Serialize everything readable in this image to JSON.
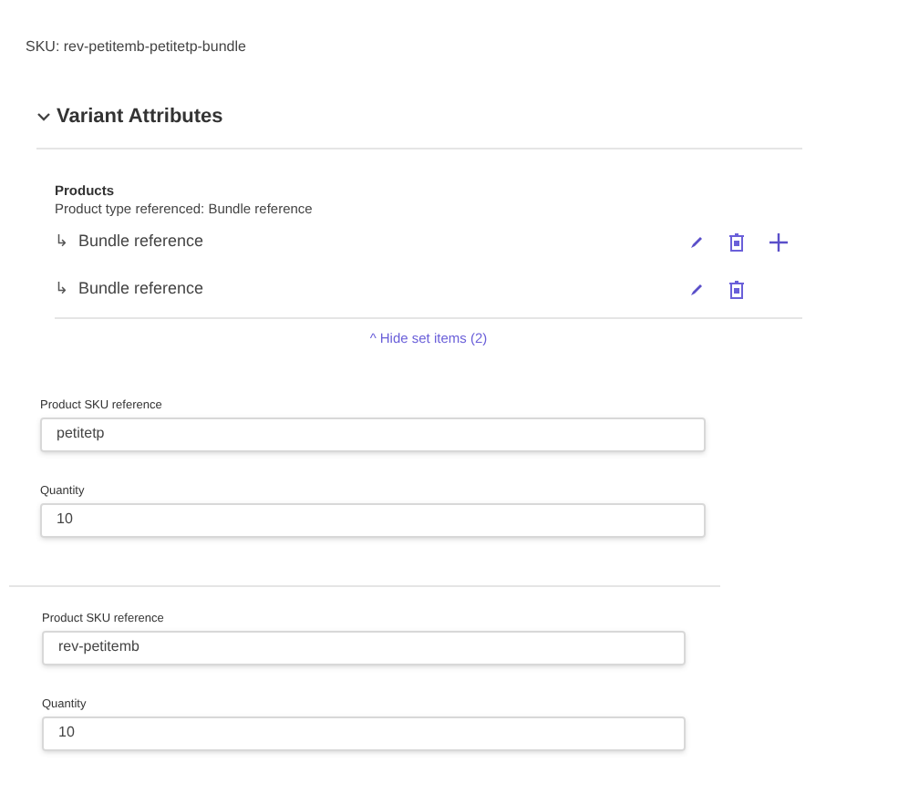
{
  "sku": "SKU: rev-petitemb-petitetp-bundle",
  "section": {
    "title": "Variant Attributes",
    "expanded": true
  },
  "attribute": {
    "label": "Products",
    "subtitle": "Product type referenced: Bundle reference",
    "items": [
      {
        "icon": "↳",
        "label": "Bundle reference",
        "can_add": true
      },
      {
        "icon": "↳",
        "label": "Bundle reference",
        "can_add": false
      }
    ],
    "toggle": {
      "icon": "^",
      "label": "Hide set items (2)"
    }
  },
  "forms": [
    {
      "fields": [
        {
          "label": "Product SKU reference",
          "value": "petitetp"
        },
        {
          "label": "Quantity",
          "value": "10"
        }
      ]
    },
    {
      "fields": [
        {
          "label": "Product SKU reference",
          "value": "rev-petitemb"
        },
        {
          "label": "Quantity",
          "value": "10"
        }
      ]
    }
  ]
}
